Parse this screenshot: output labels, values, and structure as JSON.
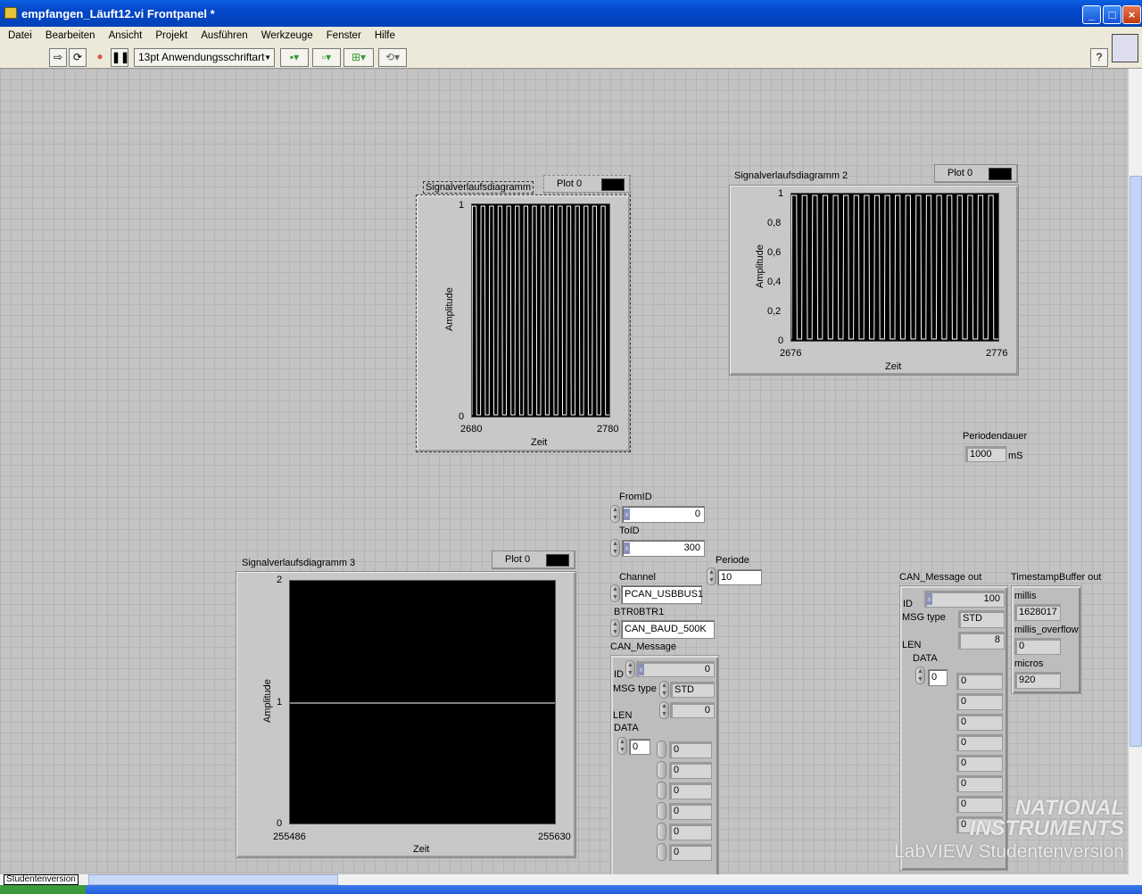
{
  "window": {
    "title": "empfangen_Läuft12.vi Frontpanel *",
    "min": "_",
    "max": "□",
    "close": "×"
  },
  "menu": [
    "Datei",
    "Bearbeiten",
    "Ansicht",
    "Projekt",
    "Ausführen",
    "Werkzeuge",
    "Fenster",
    "Hilfe"
  ],
  "toolbar": {
    "font": "13pt Anwendungsschriftart",
    "help": "?"
  },
  "charts": [
    {
      "title": "Signalverlaufsdiagramm",
      "legend": "Plot 0",
      "ylabel": "Amplitude",
      "xlabel": "Zeit",
      "yticks": [
        "1",
        "0"
      ],
      "xticks": [
        "2680",
        "2780"
      ]
    },
    {
      "title": "Signalverlaufsdiagramm 2",
      "legend": "Plot 0",
      "ylabel": "Amplitude",
      "xlabel": "Zeit",
      "yticks": [
        "1",
        "0,8",
        "0,6",
        "0,4",
        "0,2",
        "0"
      ],
      "xticks": [
        "2676",
        "2776"
      ]
    },
    {
      "title": "Signalverlaufsdiagramm 3",
      "legend": "Plot 0",
      "ylabel": "Amplitude",
      "xlabel": "Zeit",
      "yticks": [
        "2",
        "1",
        "0"
      ],
      "xticks": [
        "255486",
        "255630"
      ]
    }
  ],
  "chart_data": [
    {
      "type": "line",
      "title": "Signalverlaufsdiagramm",
      "xlabel": "Zeit",
      "ylabel": "Amplitude",
      "xlim": [
        2680,
        2780
      ],
      "ylim": [
        0,
        1
      ],
      "series": [
        {
          "name": "Plot 0",
          "kind": "square-wave",
          "low": 0,
          "high": 1,
          "periods": 16
        }
      ]
    },
    {
      "type": "line",
      "title": "Signalverlaufsdiagramm 2",
      "xlabel": "Zeit",
      "ylabel": "Amplitude",
      "xlim": [
        2676,
        2776
      ],
      "ylim": [
        0,
        1
      ],
      "series": [
        {
          "name": "Plot 0",
          "kind": "square-wave",
          "low": 0,
          "high": 1,
          "periods": 20
        }
      ]
    },
    {
      "type": "line",
      "title": "Signalverlaufsdiagramm 3",
      "xlabel": "Zeit",
      "ylabel": "Amplitude",
      "xlim": [
        255486,
        255630
      ],
      "ylim": [
        0,
        2
      ],
      "series": [
        {
          "name": "Plot 0",
          "x": [
            255486,
            255630
          ],
          "y": [
            1,
            1
          ]
        }
      ]
    }
  ],
  "periodendauer": {
    "label": "Periodendauer",
    "value": "1000",
    "unit": "mS"
  },
  "controls": {
    "fromid_label": "FromID",
    "fromid": "0",
    "toid_label": "ToID",
    "toid": "300",
    "periode_label": "Periode",
    "periode": "10",
    "channel_label": "Channel",
    "channel": "PCAN_USBBUS1",
    "btr_label": "BTR0BTR1",
    "btr": "CAN_BAUD_500K"
  },
  "can_message": {
    "label": "CAN_Message",
    "id_label": "ID",
    "id": "0",
    "msgtype_label": "MSG type",
    "msgtype": "STD",
    "len_label": "LEN",
    "len": "0",
    "data_label": "DATA",
    "index": "0",
    "data": [
      "0",
      "0",
      "0",
      "0",
      "0",
      "0"
    ]
  },
  "can_out": {
    "label": "CAN_Message out",
    "id_label": "ID",
    "id": "100",
    "msgtype_label": "MSG type",
    "msgtype": "STD",
    "len_label": "LEN",
    "len": "8",
    "data_label": "DATA",
    "index": "0",
    "data": [
      "0",
      "0",
      "0",
      "0",
      "0",
      "0",
      "0",
      "0"
    ]
  },
  "timestamp": {
    "label": "TimestampBuffer out",
    "millis_label": "millis",
    "millis": "1628017",
    "overflow_label": "millis_overflow",
    "overflow": "0",
    "micros_label": "micros",
    "micros": "920"
  },
  "watermark": {
    "line1": "NATIONAL",
    "line2": "INSTRUMENTS",
    "line3": "LabVIEW Studentenversion"
  },
  "status": {
    "version": "Studentenversion"
  }
}
